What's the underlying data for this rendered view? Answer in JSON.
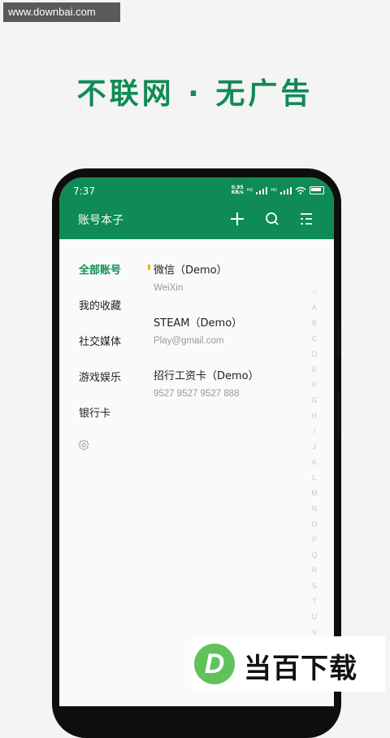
{
  "watermark": "www.downbai.com",
  "headline": "不联网 · 无广告",
  "status": {
    "time": "7:37",
    "speed_top": "0.95",
    "speed_bottom": "KB/s",
    "hd1": "HD",
    "hd2": "HD"
  },
  "appbar": {
    "title": "账号本子",
    "icons": [
      "plus-icon",
      "search-icon",
      "menu-list-icon"
    ]
  },
  "sidebar": {
    "items": [
      {
        "label": "全部账号",
        "active": true
      },
      {
        "label": "我的收藏",
        "active": false
      },
      {
        "label": "社交媒体",
        "active": false
      },
      {
        "label": "游戏娱乐",
        "active": false
      },
      {
        "label": "银行卡",
        "active": false
      }
    ],
    "settings_icon": "gear-icon"
  },
  "entries": [
    {
      "name": "微信（Demo）",
      "sub": "WeiXin"
    },
    {
      "name": "STEAM（Demo）",
      "sub": "Play@gmail.com"
    },
    {
      "name": "招行工资卡（Demo）",
      "sub": "9527 9527 9527 888"
    }
  ],
  "index_letters": [
    "☆",
    "A",
    "B",
    "C",
    "D",
    "E",
    "F",
    "G",
    "H",
    "I",
    "J",
    "K",
    "L",
    "M",
    "N",
    "O",
    "P",
    "Q",
    "R",
    "S",
    "T",
    "U",
    "V"
  ],
  "logo": {
    "mark": "D",
    "text": "当百下载"
  },
  "colors": {
    "brand_green": "#0f8b55",
    "active_marker": "#f2b200",
    "logo_green": "#60c25b"
  }
}
